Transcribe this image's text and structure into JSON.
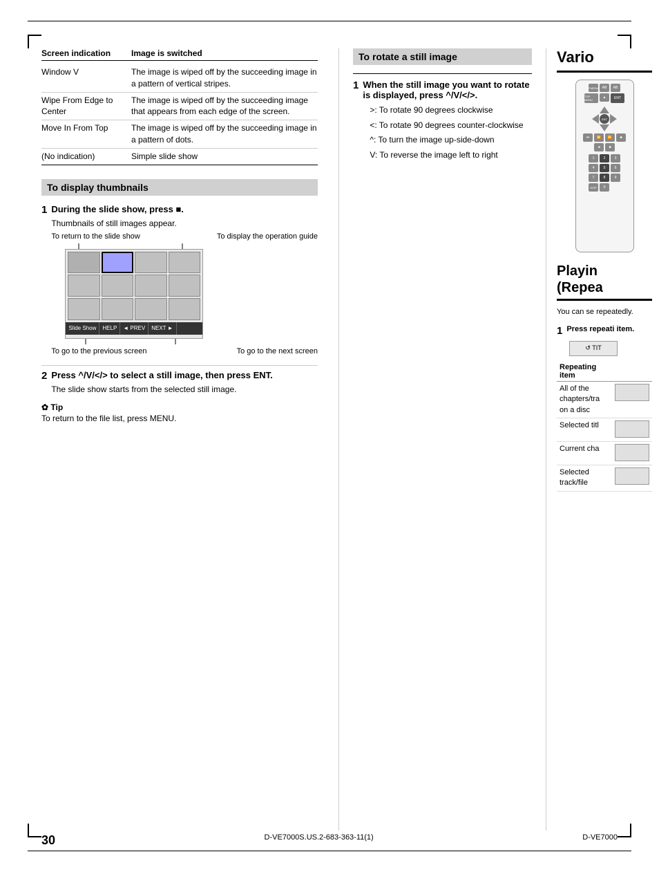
{
  "page": {
    "number": "30",
    "footer_left": "D-VE7000S.US.2-683-363-11(1)",
    "footer_right": "D-VE7000"
  },
  "table": {
    "headers": {
      "screen": "Screen indication",
      "image": "Image is switched"
    },
    "rows": [
      {
        "screen": "Window V",
        "image": "The image is wiped off by the succeeding image in a pattern of vertical stripes."
      },
      {
        "screen": "Wipe From Edge to Center",
        "image": "The image is wiped off by the succeeding image that appears from each edge of the screen."
      },
      {
        "screen": "Move In From Top",
        "image": "The image is wiped off by the succeeding image in a pattern of dots."
      },
      {
        "screen": "(No indication)",
        "image": "Simple slide show"
      }
    ]
  },
  "thumbnails_section": {
    "heading": "To display thumbnails",
    "step1": {
      "label": "1",
      "title": "During the slide show, press ■.",
      "desc": "Thumbnails of still images appear.",
      "annotation_top_left": "To return to the slide show",
      "annotation_top_right": "To display the operation guide",
      "annotation_bottom_left": "To go to the previous screen",
      "annotation_bottom_right": "To go to the next screen",
      "nav_items": [
        "Slide Show",
        "HELP",
        "◄ PREV",
        "NEXT ►"
      ]
    },
    "step2": {
      "label": "2",
      "title": "Press ^/V/</>  to select a still image, then press ENT.",
      "desc": "The slide show starts from the selected still image."
    },
    "tip": {
      "label": "✿ Tip",
      "text": "To return to the file list, press MENU."
    }
  },
  "rotate_section": {
    "heading": "To rotate a still image",
    "step1": {
      "label": "1",
      "title": "When the still image you want to rotate is displayed, press ^/V/</>.",
      "items": [
        ">: To rotate 90 degrees clockwise",
        "<: To rotate 90 degrees counter-clockwise",
        "^: To turn the image up-side-down",
        "V: To reverse the image left to right"
      ]
    }
  },
  "various_section": {
    "heading": "Vario"
  },
  "playing_section": {
    "heading_line1": "Playin",
    "heading_line2": "(Repea",
    "desc": "You can se repeatedly.",
    "step1": {
      "label": "1",
      "title": "Press repeati item."
    },
    "repeating_table": {
      "col1": "Repeating item",
      "col2": "",
      "rows": [
        {
          "item": "All of the chapters/tra on a disc",
          "screen": ""
        },
        {
          "item": "Selected titl",
          "screen": ""
        },
        {
          "item": "Current cha",
          "screen": ""
        },
        {
          "item": "Selected track/file",
          "screen": ""
        }
      ]
    }
  }
}
